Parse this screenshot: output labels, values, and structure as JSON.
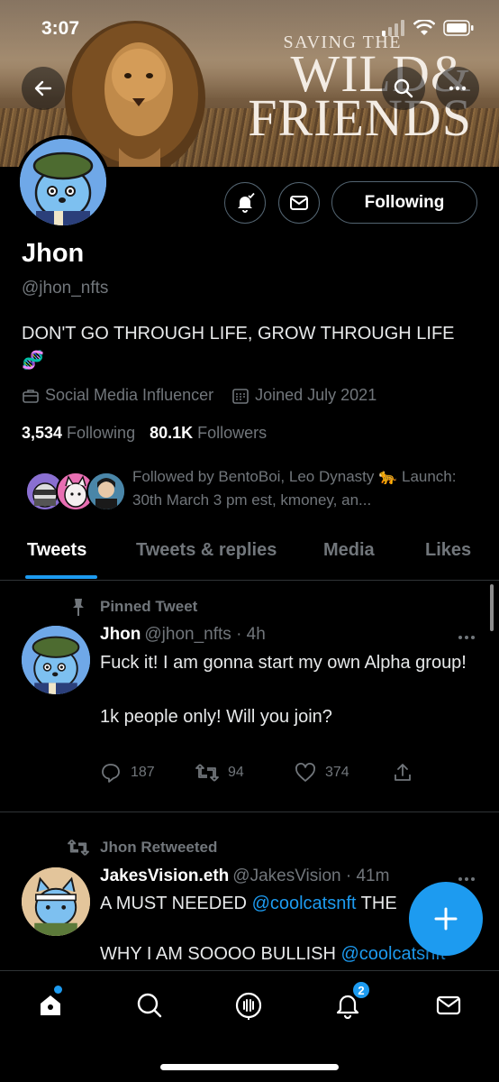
{
  "status_bar": {
    "time": "3:07"
  },
  "banner": {
    "line1": "SAVING THE",
    "line2": "WILD&",
    "line3": "FRIENDS"
  },
  "profile": {
    "name": "Jhon",
    "handle": "@jhon_nfts",
    "bio": "DON'T GO THROUGH LIFE, GROW THROUGH LIFE 🧬",
    "category": "Social Media Influencer",
    "joined": "Joined July 2021",
    "following_count": "3,534",
    "following_label": "Following",
    "followers_count": "80.1K",
    "followers_label": "Followers",
    "following_button": "Following",
    "followed_by": "Followed by BentoBoi, Leo Dynasty 🐆 Launch: 30th March 3 pm est, kmoney, an..."
  },
  "tabs": [
    "Tweets",
    "Tweets & replies",
    "Media",
    "Likes"
  ],
  "pinned_tweet": {
    "label": "Pinned Tweet",
    "name": "Jhon",
    "handle_time": "@jhon_nfts · 4h",
    "text": "Fuck it! I am gonna start my own Alpha group!\n\n1k people only! Will you join?",
    "replies": "187",
    "retweets": "94",
    "likes": "374"
  },
  "retweet": {
    "label": "Jhon Retweeted",
    "name": "JakesVision.eth",
    "handle_time": "@JakesVision · 41m",
    "line1_prefix": "A MUST NEEDED ",
    "line1_link": "@coolcatsnft",
    "line1_suffix": " THE",
    "line2_prefix": "WHY I AM SOOOO BULLISH ",
    "line2_link": "@coolcatsnft"
  },
  "bottom_nav": {
    "notifications_badge": "2"
  },
  "colors": {
    "accent": "#1d9bf0",
    "muted": "#71767b",
    "divider": "#2f3336"
  }
}
